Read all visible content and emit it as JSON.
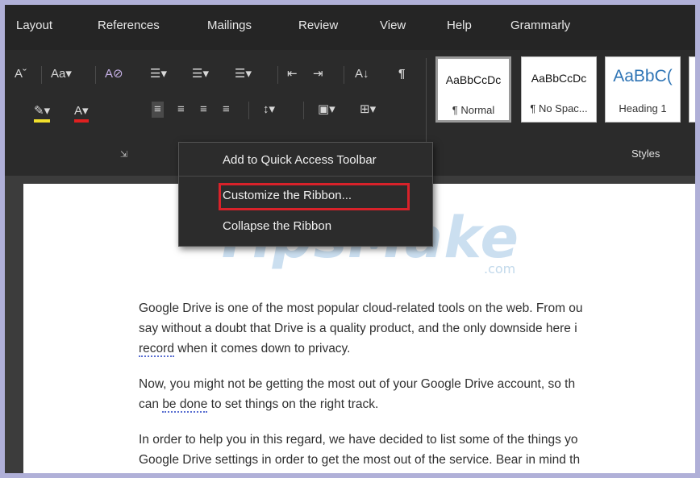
{
  "tabs": [
    "Layout",
    "References",
    "Mailings",
    "Review",
    "View",
    "Help",
    "Grammarly"
  ],
  "ribbon_icons": {
    "font_size_down": "Aˇ",
    "change_case": "Aa▾",
    "clear_format": "A⊘",
    "bullets": "☰▾",
    "numbering": "☰▾",
    "multilevel": "☰▾",
    "decrease_indent": "⇤",
    "increase_indent": "⇥",
    "sort": "A↓",
    "pilcrow": "¶",
    "highlight": "✎▾",
    "font_color": "A▾",
    "align_left": "≡",
    "align_center": "≡",
    "align_right": "≡",
    "justify": "≡",
    "line_spacing": "↕▾",
    "shading": "▣▾",
    "borders": "⊞▾",
    "launcher": "⇲"
  },
  "styles": [
    {
      "sample": "AaBbCcDc",
      "name": "¶ Normal",
      "kind": "normal"
    },
    {
      "sample": "AaBbCcDc",
      "name": "¶ No Spac...",
      "kind": "normal"
    },
    {
      "sample": "AaBbC(",
      "name": "Heading 1",
      "kind": "heading"
    }
  ],
  "group_label": "Styles",
  "context_menu": {
    "add_quick_access": "Add to Quick Access Toolbar",
    "customize_ribbon": "Customize the Ribbon...",
    "collapse_ribbon": "Collapse the Ribbon"
  },
  "watermark": {
    "text": "TipsMake",
    "suffix": ".com"
  },
  "document": {
    "p1_l1": "Google Drive is one of the most popular cloud-related tools on the web. From ou",
    "p1_l2": "say without a doubt that Drive is a quality product, and the only downside here i",
    "p1_l3_a": "record",
    "p1_l3_b": " when it comes down to privacy.",
    "p2_l1": "Now, you might not be getting the most out of your Google Drive account, so th",
    "p2_l2_a": "can ",
    "p2_l2_b": "be done",
    "p2_l2_c": " to set things on the right track.",
    "p3_l1": "In order to help you in this regard, we have decided to list some of the things yo",
    "p3_l2": "Google Drive settings in order to get the most out of the service. Bear in mind th"
  },
  "colors": {
    "accent_red": "#d8222a",
    "highlight_yellow": "#f2e02c",
    "font_red": "#e02020",
    "heading_blue": "#2e74b5"
  }
}
